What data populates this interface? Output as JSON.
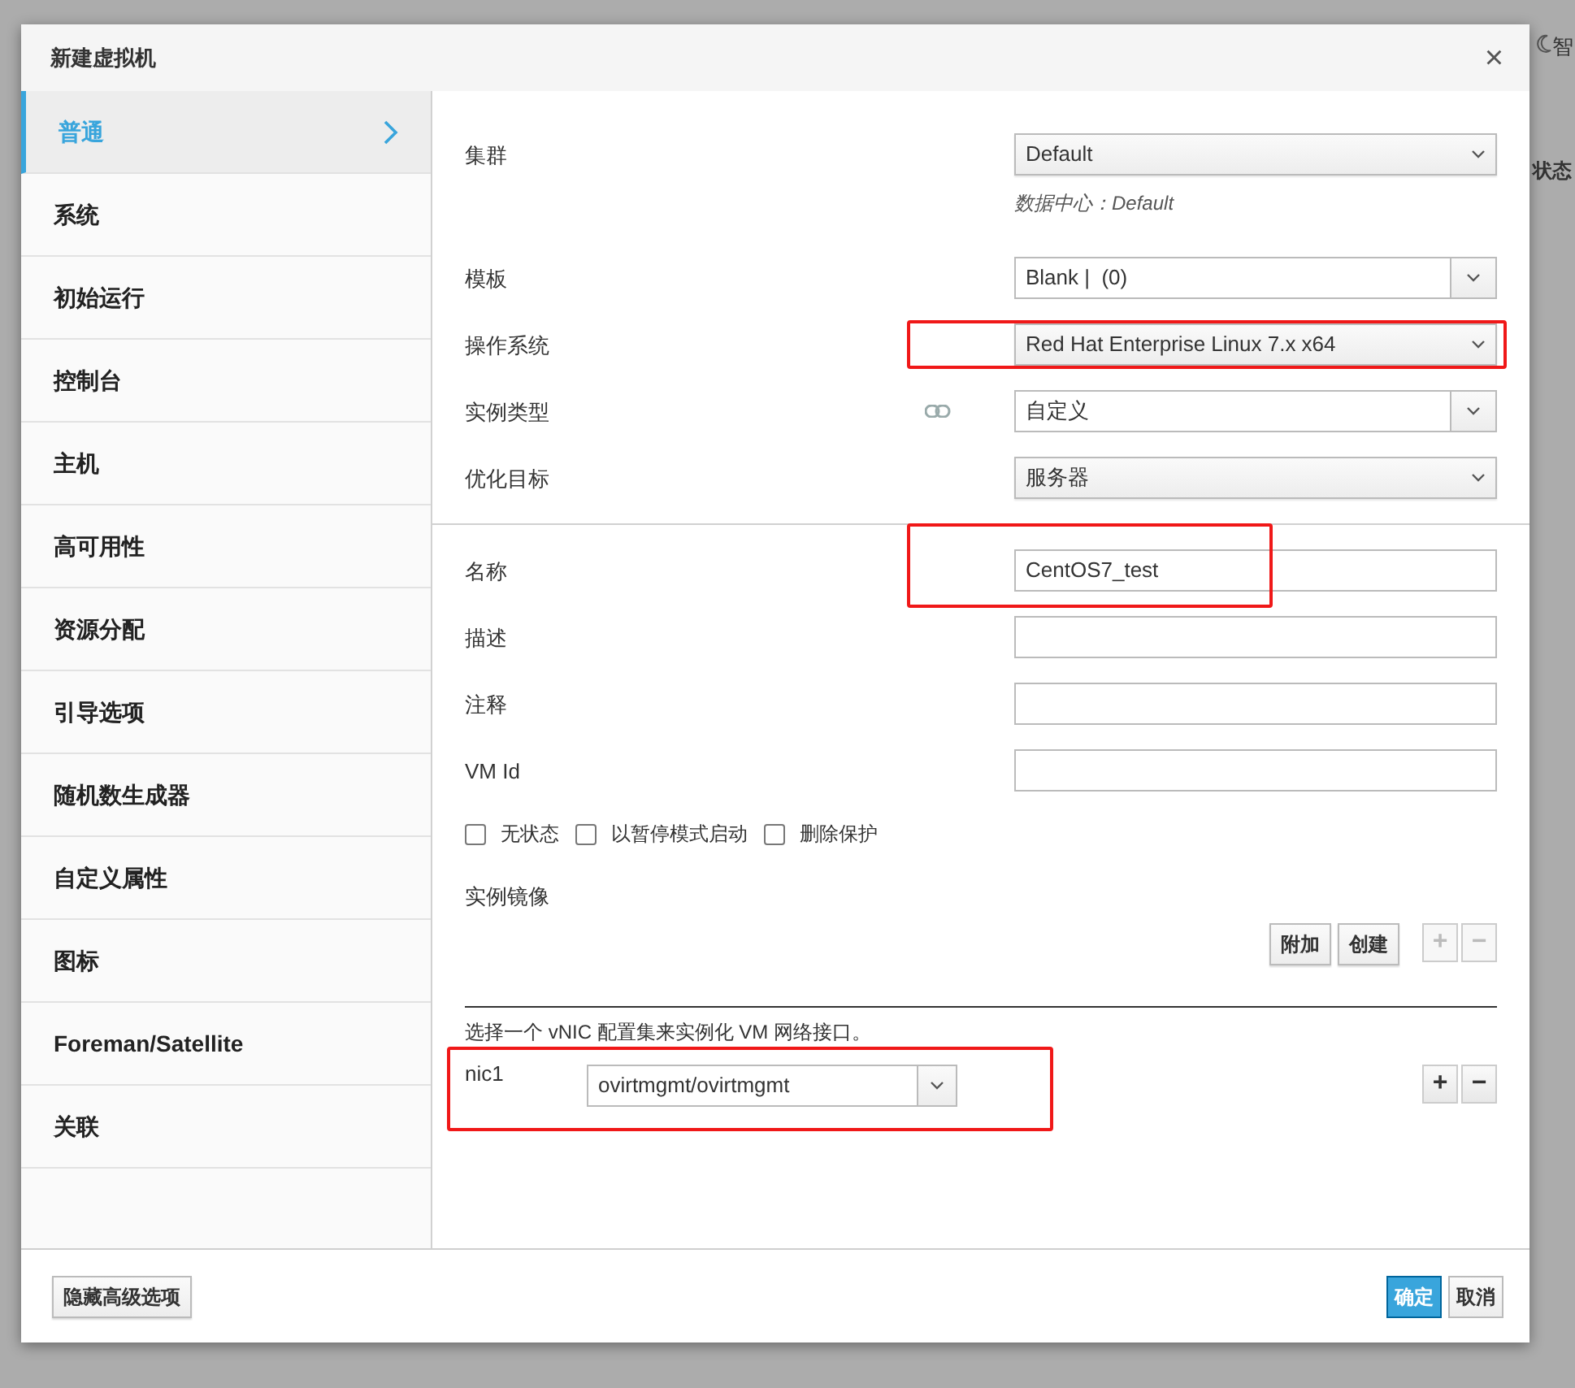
{
  "background": {
    "corner_text": "智",
    "column_header": "状态"
  },
  "dialog": {
    "title": "新建虚拟机",
    "close": "×"
  },
  "sidebar": [
    {
      "label": "普通",
      "selected": true
    },
    {
      "label": "系统",
      "selected": false
    },
    {
      "label": "初始运行",
      "selected": false
    },
    {
      "label": "控制台",
      "selected": false
    },
    {
      "label": "主机",
      "selected": false
    },
    {
      "label": "高可用性",
      "selected": false
    },
    {
      "label": "资源分配",
      "selected": false
    },
    {
      "label": "引导选项",
      "selected": false
    },
    {
      "label": "随机数生成器",
      "selected": false
    },
    {
      "label": "自定义属性",
      "selected": false
    },
    {
      "label": "图标",
      "selected": false
    },
    {
      "label": "Foreman/Satellite",
      "selected": false
    },
    {
      "label": "关联",
      "selected": false
    }
  ],
  "general_fields": [
    {
      "kind": "select",
      "label": "集群",
      "value": "Default",
      "hint": "数据中心：Default",
      "highlighted": false,
      "linked": false
    },
    {
      "kind": "combo",
      "label": "模板",
      "value": "Blank |  (0)",
      "highlighted": false,
      "linked": false
    },
    {
      "kind": "select",
      "label": "操作系统",
      "value": "Red Hat Enterprise Linux 7.x x64",
      "highlighted": true,
      "linked": false
    },
    {
      "kind": "combo",
      "label": "实例类型",
      "value": "自定义",
      "highlighted": false,
      "linked": true
    },
    {
      "kind": "select",
      "label": "优化目标",
      "value": "服务器",
      "highlighted": false,
      "linked": false
    }
  ],
  "name_fields": [
    {
      "kind": "input",
      "label": "名称",
      "value": "CentOS7_test",
      "highlighted": true
    },
    {
      "kind": "input",
      "label": "描述",
      "highlighted": false
    },
    {
      "kind": "input",
      "label": "注释",
      "highlighted": false
    },
    {
      "kind": "input",
      "label": "VM Id",
      "highlighted": false
    }
  ],
  "checkboxes": [
    {
      "label": "无状态",
      "checked": false
    },
    {
      "label": "以暂停模式启动",
      "checked": false
    },
    {
      "label": "删除保护",
      "checked": false
    }
  ],
  "instance_images": {
    "label": "实例镜像",
    "buttons": [
      "附加",
      "创建"
    ],
    "add": "+",
    "remove": "−",
    "disabled": true
  },
  "vnic": {
    "instructions": "选择一个 vNIC 配置集来实例化 VM 网络接口。",
    "add": "+",
    "remove": "−",
    "disabled": false,
    "interfaces": [
      {
        "name": "nic1",
        "profile": "ovirtmgmt/ovirtmgmt",
        "highlighted": true
      }
    ]
  },
  "footer": {
    "advanced_button": "隐藏高级选项",
    "ok": "确定",
    "cancel": "取消"
  }
}
